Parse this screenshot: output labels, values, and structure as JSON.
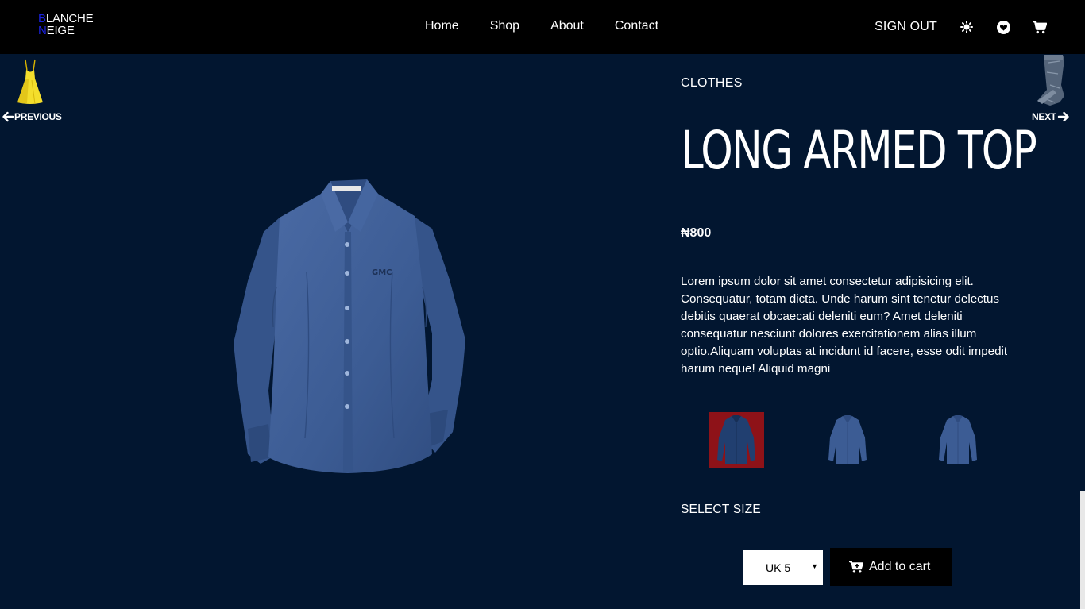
{
  "brand": {
    "line1_cap": "B",
    "line1_rest": "LANCHE",
    "line2_cap": "N",
    "line2_rest": "EIGE"
  },
  "nav": {
    "links": [
      "Home",
      "Shop",
      "About",
      "Contact"
    ],
    "sign_out": "SIGN OUT",
    "icons": [
      "sun-icon",
      "heart-icon",
      "cart-icon"
    ]
  },
  "pager": {
    "previous_label": "PREVIOUS",
    "next_label": "NEXT",
    "previous_thumb": "yellow-dress",
    "next_thumb": "jeans"
  },
  "product": {
    "category": "CLOTHES",
    "title": "LONG ARMED TOP",
    "price": "₦800",
    "description": "Lorem ipsum dolor sit amet consectetur adipisicing elit. Consequatur, totam dicta. Unde harum sint tenetur delectus debitis quaerat obcaecati deleniti eum? Amet deleniti consequatur nesciunt dolores exercitationem alias illum optio.Aliquam voluptas at incidunt id facere, esse odit impedit harum neque! Aliquid magni",
    "shirt_logo": "GMC",
    "thumbnails_selected_index": 0,
    "size_label": "SELECT SIZE",
    "size_value": "UK 5",
    "add_to_cart": "Add to cart"
  },
  "colors": {
    "background": "#021630",
    "navbar": "#000000",
    "logo_accent": "#1a22e0",
    "selected_thumb": "#8e1218",
    "shirt": "#3c5c94"
  }
}
